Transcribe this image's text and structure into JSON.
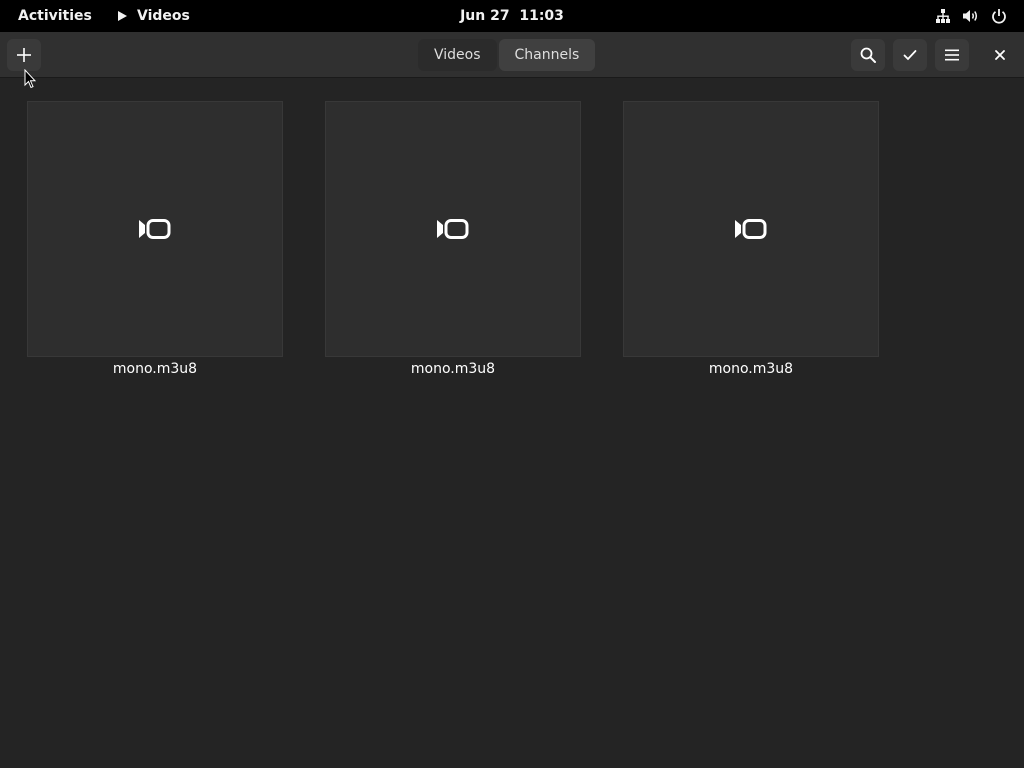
{
  "topbar": {
    "activities_label": "Activities",
    "app_name": "Videos",
    "clock": "Jun 27  11:03",
    "tray_icons": [
      "network-icon",
      "volume-icon",
      "power-icon"
    ]
  },
  "headerbar": {
    "add_icon": "plus-icon",
    "tabs": [
      {
        "label": "Videos",
        "active": true
      },
      {
        "label": "Channels",
        "active": false
      }
    ],
    "right_icons": [
      "search-icon",
      "checkmark-icon",
      "hamburger-menu-icon",
      "close-icon"
    ]
  },
  "videos": [
    {
      "name": "mono.m3u8",
      "icon": "video-camera-icon"
    },
    {
      "name": "mono.m3u8",
      "icon": "video-camera-icon"
    },
    {
      "name": "mono.m3u8",
      "icon": "video-camera-icon"
    }
  ],
  "colors": {
    "topbar_bg": "#000000",
    "headerbar_bg": "#303030",
    "content_bg": "#242424",
    "thumb_bg": "#2e2e2e"
  }
}
